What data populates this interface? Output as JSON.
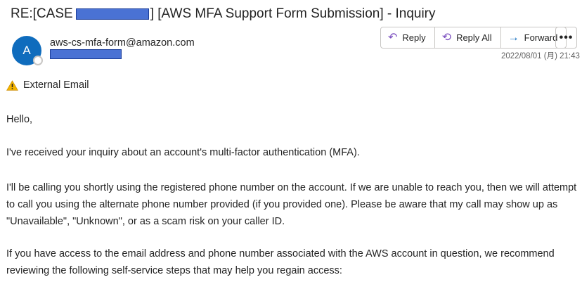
{
  "email": {
    "subject_prefix": "RE:[CASE",
    "subject_suffix": "] [AWS MFA Support Form Submission] - Inquiry",
    "avatar_letter": "A",
    "sender": "aws-cs-mfa-form@amazon.com",
    "timestamp": "2022/08/01 (月) 21:43",
    "external_label": "External Email"
  },
  "toolbar": {
    "reply_label": "Reply",
    "reply_all_label": "Reply All",
    "forward_label": "Forward",
    "more_label": "•••"
  },
  "body": {
    "p1": "Hello,",
    "p2": "I've received your inquiry about an account's multi-factor authentication (MFA).",
    "p3_line1": "I'll be calling you shortly using the registered phone number on the account. If we are unable to reach you, then we will attempt",
    "p3_line2": "to call you using the alternate phone number provided (if you provided one). Please be aware that my call may show up as",
    "p3_line3": "\"Unavailable\", \"Unknown\", or as a scam risk on your caller ID.",
    "p4_line1": "If you have access to the email address and phone number associated with the AWS account in question, we recommend",
    "p4_line2": "reviewing the following self-service steps that may help you regain access:"
  },
  "icons": {
    "reply": "reply-icon",
    "reply_all": "reply-all-icon",
    "forward": "forward-icon",
    "more": "more-options-icon",
    "warning": "warning-icon"
  },
  "colors": {
    "avatar": "#0f6cbd",
    "redaction": "#4a72d4",
    "reply_icon": "#7b4fbf",
    "forward_icon": "#0f6cbd",
    "warning": "#f2b300"
  }
}
